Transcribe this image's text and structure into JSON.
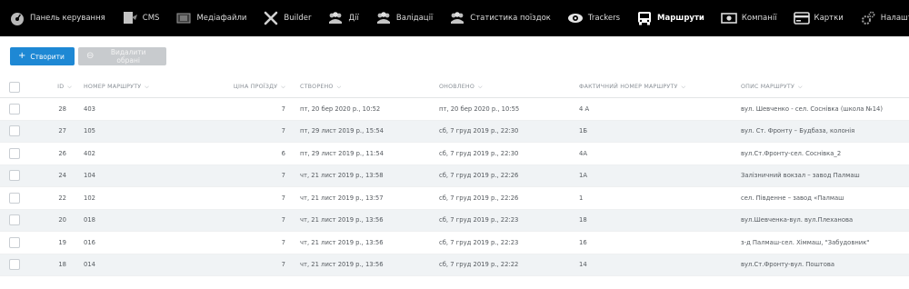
{
  "nav": [
    {
      "label": "Панель керування",
      "icon": "dashboard-icon"
    },
    {
      "label": "CMS",
      "icon": "cms-icon"
    },
    {
      "label": "Медіафайли",
      "icon": "media-icon"
    },
    {
      "label": "Builder",
      "icon": "wrench-icon"
    },
    {
      "label": "Дії",
      "icon": "users-icon"
    },
    {
      "label": "Валідації",
      "icon": "users-icon"
    },
    {
      "label": "Статистика поїздок",
      "icon": "users-icon"
    },
    {
      "label": "Trackers",
      "icon": "eye-icon"
    },
    {
      "label": "Маршрути",
      "icon": "bus-icon",
      "active": true
    },
    {
      "label": "Компанії",
      "icon": "money-icon"
    },
    {
      "label": "Картки",
      "icon": "card-icon"
    },
    {
      "label": "Налаштування",
      "icon": "gears-icon"
    }
  ],
  "toolbar": {
    "create_label": "Створити",
    "delete_label": "Видалити обрані"
  },
  "columns": {
    "id": "ID",
    "route_number": "НОМЕР МАРШРУТУ",
    "price": "ЦІНА ПРОЇЗДУ",
    "created": "СТВОРЕНО",
    "updated": "ОНОВЛЕНО",
    "actual_number": "ФАКТИЧНИЙ НОМЕР МАРШРУТУ",
    "description": "ОПИС МАРШРУТУ"
  },
  "rows": [
    {
      "id": "28",
      "route_number": "403",
      "price": "7",
      "created": "пт, 20 бер 2020 р., 10:52",
      "updated": "пт, 20 бер 2020 р., 10:55",
      "actual_number": "4 А",
      "description": "вул. Шевченко - сел. Соснівка (школа №14)"
    },
    {
      "id": "27",
      "route_number": "105",
      "price": "7",
      "created": "пт, 29 лист 2019 р., 15:54",
      "updated": "сб, 7 груд 2019 р., 22:30",
      "actual_number": "1Б",
      "description": "вул. Ст. Фронту – Будбаза, колонія"
    },
    {
      "id": "26",
      "route_number": "402",
      "price": "6",
      "created": "пт, 29 лист 2019 р., 11:54",
      "updated": "сб, 7 груд 2019 р., 22:30",
      "actual_number": "4А",
      "description": "вул.Ст.Фронту-сел. Соснівка_2"
    },
    {
      "id": "24",
      "route_number": "104",
      "price": "7",
      "created": "чт, 21 лист 2019 р., 13:58",
      "updated": "сб, 7 груд 2019 р., 22:26",
      "actual_number": "1А",
      "description": "Залізничний вокзал – завод Палмаш"
    },
    {
      "id": "22",
      "route_number": "102",
      "price": "7",
      "created": "чт, 21 лист 2019 р., 13:57",
      "updated": "сб, 7 груд 2019 р., 22:26",
      "actual_number": "1",
      "description": "сел. Південне – завод «Палмаш"
    },
    {
      "id": "20",
      "route_number": "018",
      "price": "7",
      "created": "чт, 21 лист 2019 р., 13:56",
      "updated": "сб, 7 груд 2019 р., 22:23",
      "actual_number": "18",
      "description": "вул.Шевченка-вул. вул.Плеханова"
    },
    {
      "id": "19",
      "route_number": "016",
      "price": "7",
      "created": "чт, 21 лист 2019 р., 13:56",
      "updated": "сб, 7 груд 2019 р., 22:23",
      "actual_number": "16",
      "description": "з-д Палмаш-сел. Хіммаш, \"Забудовник\""
    },
    {
      "id": "18",
      "route_number": "014",
      "price": "7",
      "created": "чт, 21 лист 2019 р., 13:56",
      "updated": "сб, 7 груд 2019 р., 22:22",
      "actual_number": "14",
      "description": "вул.Ст.Фронту-вул. Поштова"
    }
  ]
}
